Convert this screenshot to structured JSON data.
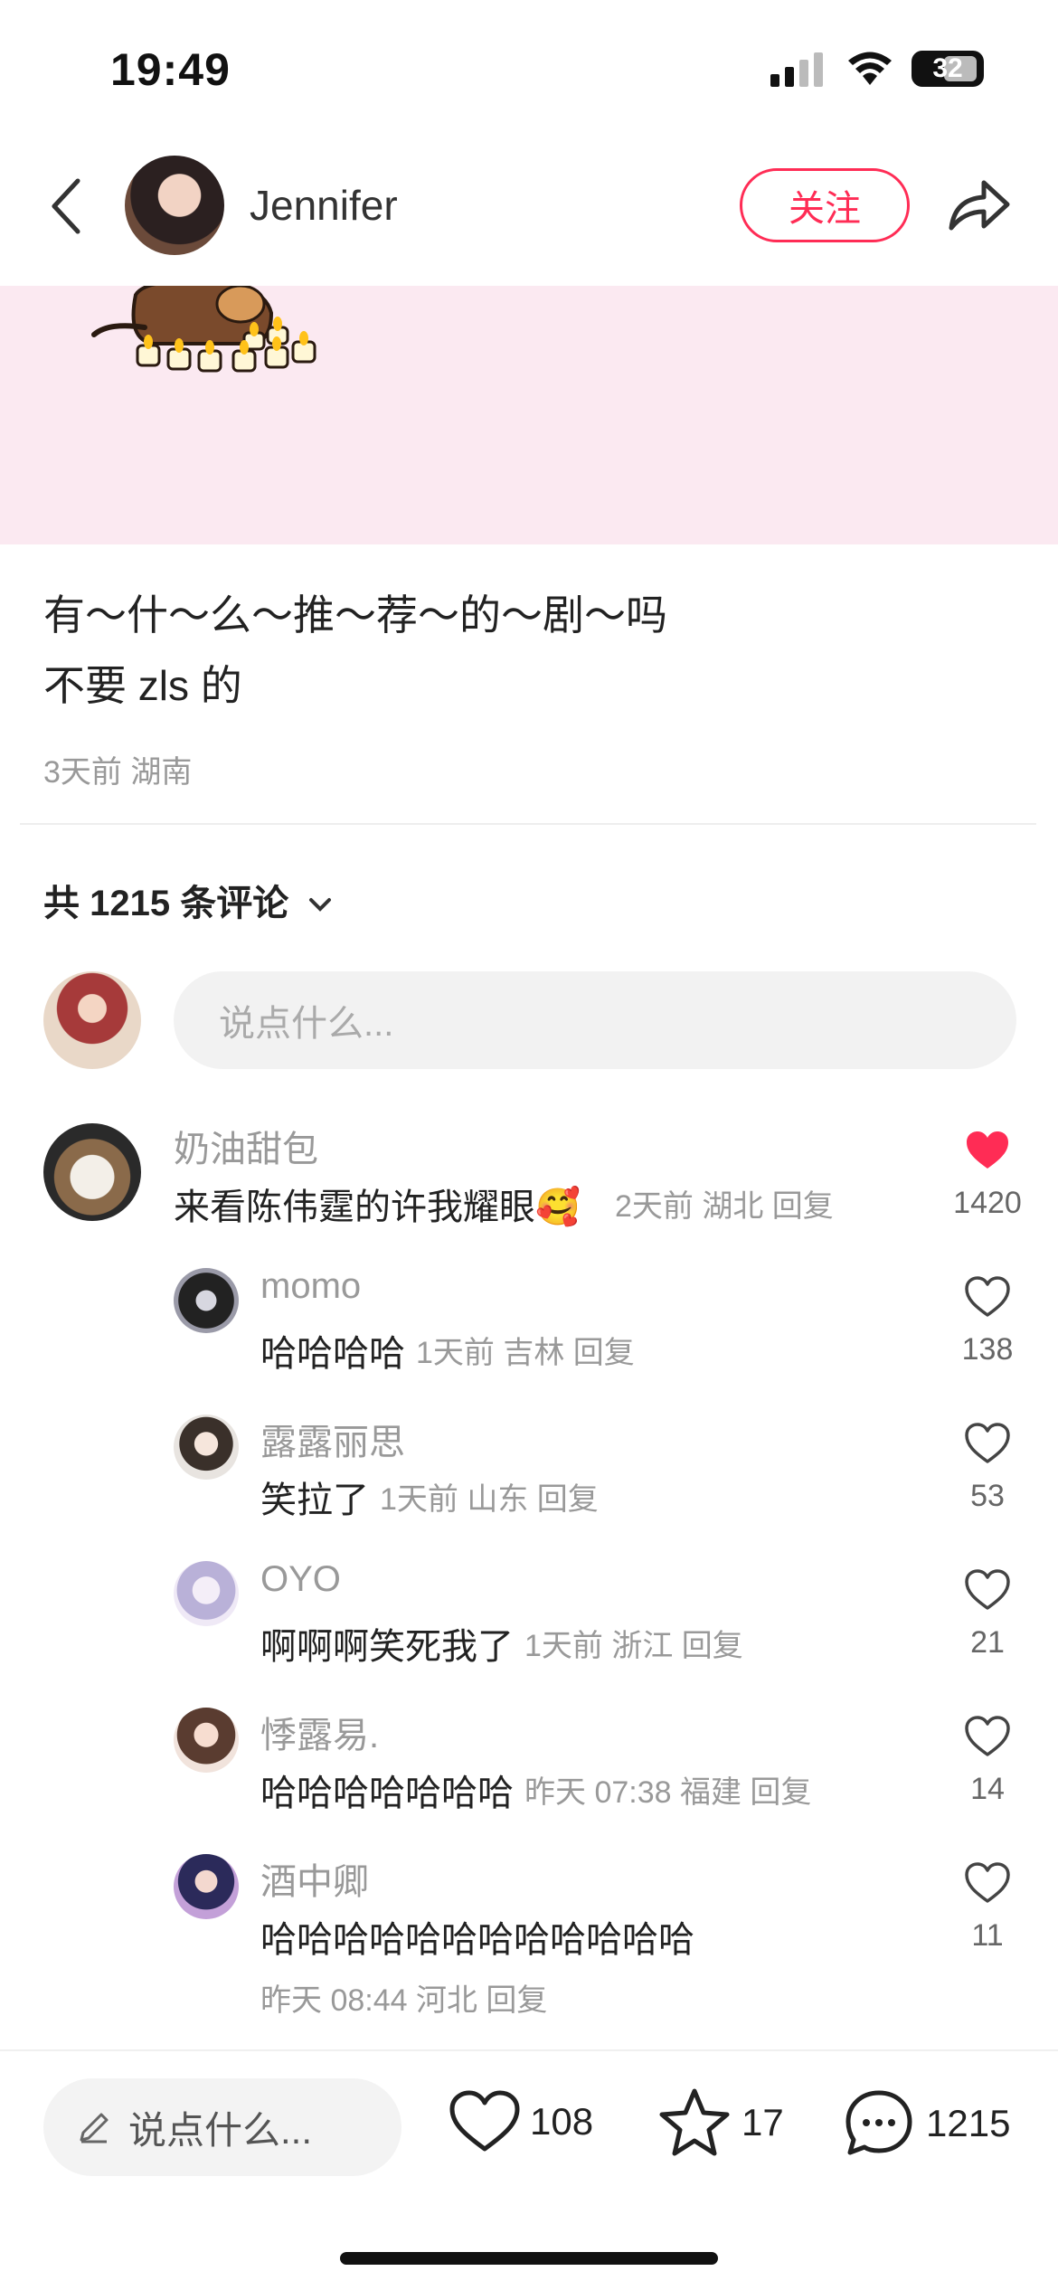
{
  "status_bar": {
    "time": "19:49",
    "battery": "32"
  },
  "header": {
    "author_name": "Jennifer",
    "follow_label": "关注"
  },
  "post": {
    "lines": [
      "有～什～么～推～荐～的～剧～吗",
      "不要 zls 的"
    ],
    "meta": "3天前 湖南"
  },
  "comments_header": {
    "label": "共 1215 条评论"
  },
  "comment_input": {
    "placeholder": "说点什么..."
  },
  "comments": [
    {
      "name": "奶油甜包",
      "text": "来看陈伟霆的许我耀眼🥰",
      "meta": "2天前 湖北 回复",
      "likes": "1420",
      "liked": true,
      "reply": false
    },
    {
      "name": "momo",
      "text": "哈哈哈哈",
      "meta": "1天前 吉林 回复",
      "likes": "138",
      "liked": false,
      "reply": true
    },
    {
      "name": "露露丽思",
      "text": "笑拉了",
      "meta": "1天前 山东 回复",
      "likes": "53",
      "liked": false,
      "reply": true
    },
    {
      "name": "OYO",
      "text": "啊啊啊笑死我了",
      "meta": "1天前 浙江 回复",
      "likes": "21",
      "liked": false,
      "reply": true
    },
    {
      "name": "悸露易.",
      "text": "哈哈哈哈哈哈哈",
      "meta": "昨天 07:38 福建 回复",
      "likes": "14",
      "liked": false,
      "reply": true
    },
    {
      "name": "酒中卿",
      "text": "哈哈哈哈哈哈哈哈哈哈哈哈",
      "meta": "昨天 08:44 河北 回复",
      "likes": "11",
      "liked": false,
      "reply": true
    }
  ],
  "bottom_bar": {
    "input_placeholder": "说点什么...",
    "likes": "108",
    "favorites": "17",
    "comments": "1215"
  },
  "colors": {
    "accent": "#ff2c55",
    "liked": "#ff2c55",
    "image_bg": "#fbe9f1"
  },
  "icons": [
    "back-chevron-icon",
    "share-icon",
    "heart-icon",
    "star-icon",
    "chat-bubble-icon",
    "pencil-icon",
    "chevron-down-icon",
    "signal-icon",
    "wifi-icon",
    "battery-icon"
  ]
}
